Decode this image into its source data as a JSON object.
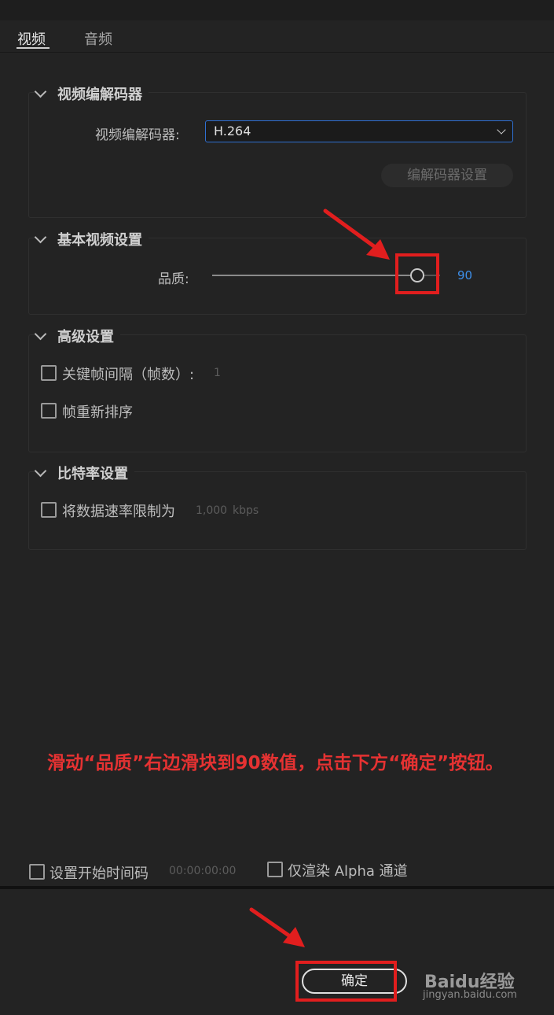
{
  "tabs": [
    {
      "label": "视频",
      "active": true
    },
    {
      "label": "音频",
      "active": false
    }
  ],
  "sections": {
    "codec": {
      "title": "视频编解码器",
      "field_label": "视频编解码器:",
      "selected_value": "H.264",
      "settings_button": "编解码器设置"
    },
    "basic": {
      "title": "基本视频设置",
      "quality_label": "品质:",
      "quality_value": "90",
      "quality_fraction": 0.9
    },
    "advanced": {
      "title": "高级设置",
      "keyframe_label": "关键帧间隔（帧数）:",
      "keyframe_value": "1",
      "reorder_label": "帧重新排序"
    },
    "bitrate": {
      "title": "比特率设置",
      "limit_label": "将数据速率限制为",
      "limit_value": "1,000",
      "limit_unit": "kbps"
    }
  },
  "footer": {
    "timecode_label": "设置开始时间码",
    "timecode_value": "00:00:00:00",
    "alpha_label": "仅渲染 Alpha 通道",
    "ok_button": "确定"
  },
  "annotation": "滑动“品质”右边滑块到90数值，点击下方“确定”按钮。",
  "watermark": {
    "brand": "Baidu经验",
    "url": "jingyan.baidu.com"
  },
  "colors": {
    "background": "#232323",
    "accent_blue": "#3d8ee8",
    "annotation_red": "#e53232"
  },
  "icons": [
    "chevron-down-icon",
    "checkbox-icon",
    "dropdown-arrow-icon",
    "arrow-annotation-icon"
  ]
}
